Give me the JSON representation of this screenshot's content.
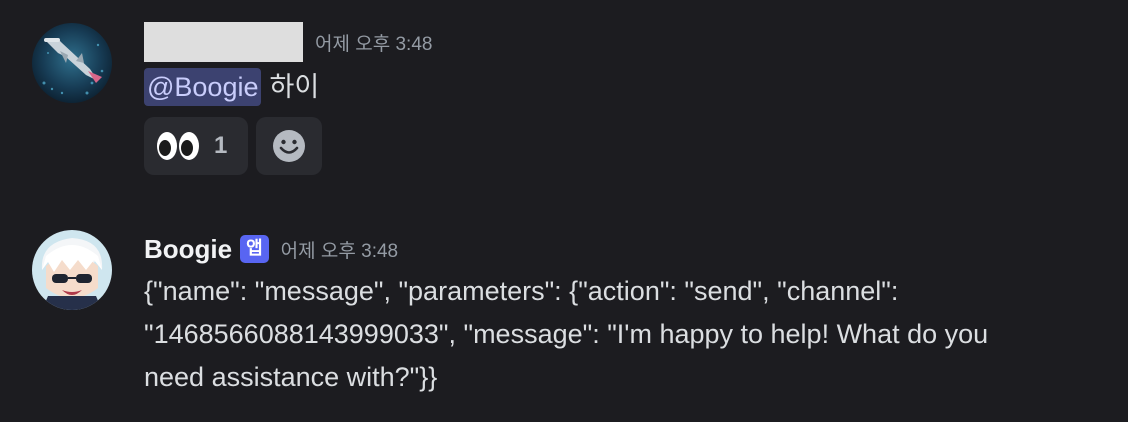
{
  "colors": {
    "background": "#1c1c20",
    "text": "#dbdee1",
    "timestamp": "#949ba4",
    "mention_bg": "#3c4270",
    "mention_text": "#c9cdfb",
    "app_badge": "#5865f2",
    "reaction_bg": "#2a2b30"
  },
  "messages": [
    {
      "author": "",
      "author_redacted": true,
      "avatar_icon": "hammerhead-shark-avatar",
      "timestamp": "어제 오후 3:48",
      "mention": "@Boogie",
      "text": "하이",
      "reactions": [
        {
          "emoji_icon": "eyes-emoji-icon",
          "count": "1"
        }
      ],
      "add_reaction_icon": "add-reaction-smiley-icon"
    },
    {
      "author": "Boogie",
      "avatar_icon": "anime-character-avatar",
      "badge": "앱",
      "timestamp": "어제 오후 3:48",
      "text": "{\"name\": \"message\", \"parameters\": {\"action\": \"send\", \"channel\": \"1468566088143999033\", \"message\": \"I'm happy to help! What do you need assistance with?\"}}"
    }
  ]
}
